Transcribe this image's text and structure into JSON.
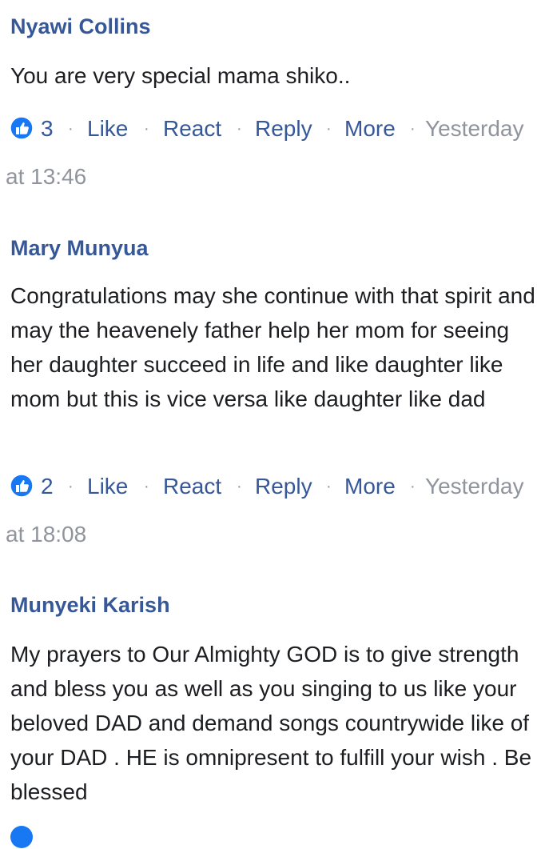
{
  "comments": [
    {
      "author": "Nyawi Collins",
      "text": "You are very special mama shiko..",
      "likes": "3",
      "actions": {
        "like": "Like",
        "react": "React",
        "reply": "Reply",
        "more": "More"
      },
      "time_line1": "Yesterday",
      "time_line2": "at 13:46"
    },
    {
      "author": "Mary Munyua",
      "text": "Congratulations may she continue with that spirit and may the heavenely father help her mom for seeing her daughter succeed in life and like daughter like mom but this is vice versa like daughter like dad",
      "likes": "2",
      "actions": {
        "like": "Like",
        "react": "React",
        "reply": "Reply",
        "more": "More"
      },
      "time_line1": "Yesterday",
      "time_line2": "at 18:08"
    },
    {
      "author": "Munyeki Karish",
      "text": "My prayers to Our Almighty GOD is to give strength and bless you as well as you singing to us like your beloved DAD and demand songs countrywide like of your DAD . HE is omnipresent to fulfill your wish . Be blessed"
    }
  ],
  "separator": "·",
  "colors": {
    "author": "#365899",
    "link": "#365899",
    "meta": "#90949c",
    "like_badge": "#1877f2"
  },
  "icons": {
    "like_badge": "thumbs-up-icon"
  }
}
